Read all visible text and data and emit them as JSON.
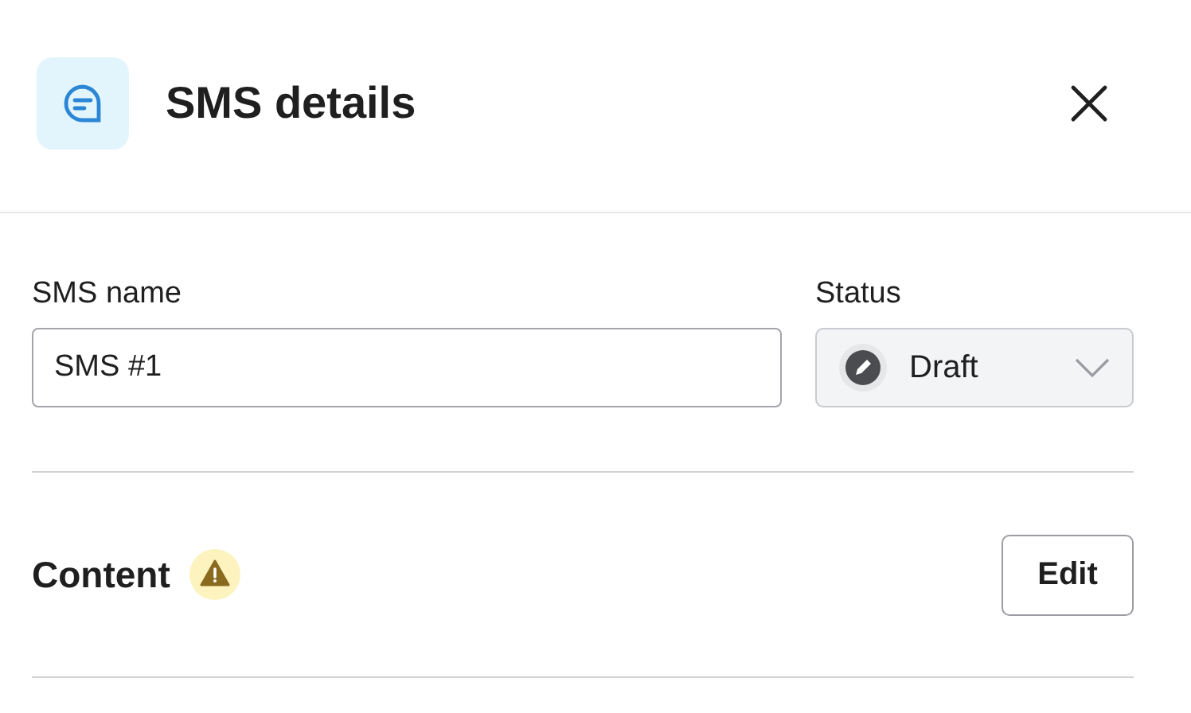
{
  "header": {
    "title": "SMS details"
  },
  "name_field": {
    "label": "SMS name",
    "value": "SMS #1"
  },
  "status_field": {
    "label": "Status",
    "value": "Draft"
  },
  "content_section": {
    "title": "Content",
    "warning": true,
    "button": "Edit"
  }
}
